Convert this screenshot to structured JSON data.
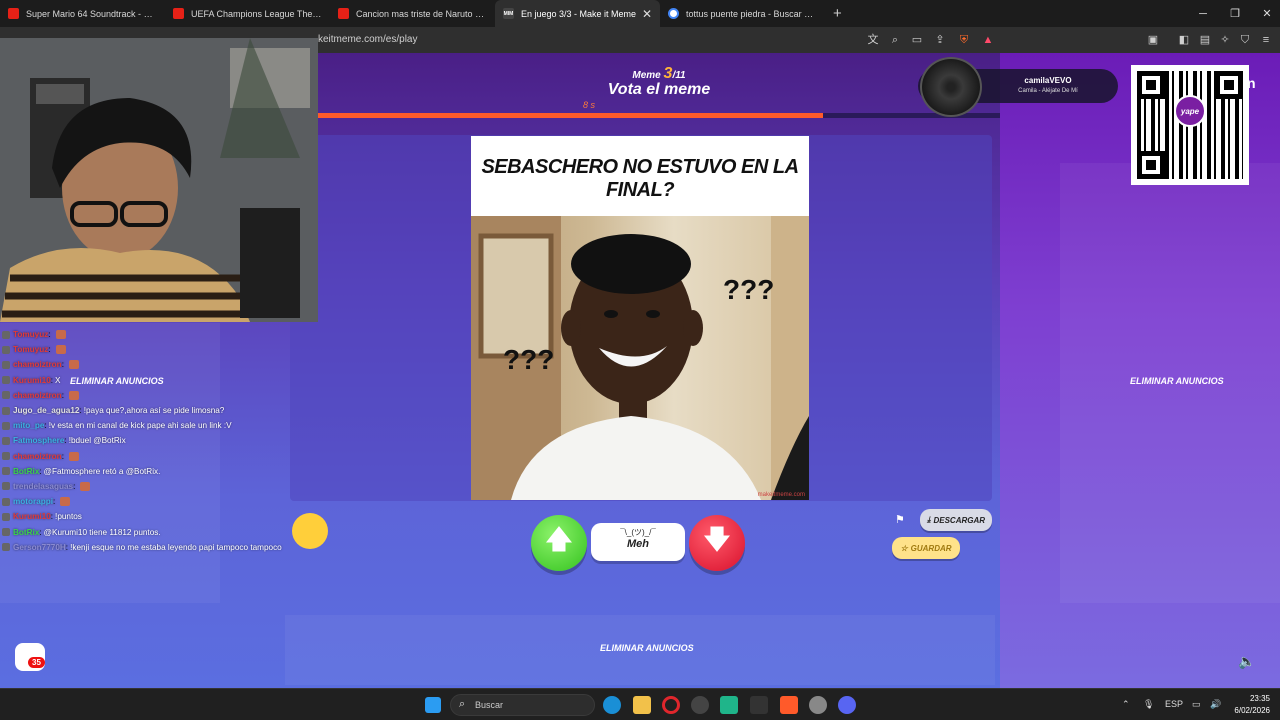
{
  "browser": {
    "tabs": [
      {
        "title": "Super Mario 64 Soundtrack - Staff Ro",
        "icon": "youtube-icon"
      },
      {
        "title": "UEFA Champions League Theme - Al",
        "icon": "youtube-icon"
      },
      {
        "title": "Cancion mas triste de Naruto (Sadne",
        "icon": "youtube-icon"
      },
      {
        "title": "En juego 3/3 - Make it Meme",
        "icon": "makeitmeme-icon",
        "active": true
      },
      {
        "title": "tottus puente piedra - Buscar con Go",
        "icon": "google-icon"
      }
    ],
    "active_tab_close": "✕",
    "new_tab": "+",
    "url": "keitmeme.com/es/play"
  },
  "game": {
    "round_label": "Meme",
    "round_current": "3",
    "round_total": "/11",
    "vote_title": "Vota el meme",
    "timer_label": "8 s",
    "timer_progress": 0.74,
    "meme": {
      "caption": "SEBASCHERO NO ESTUVO EN LA FINAL?",
      "question_marks_left": "???",
      "question_marks_right": "???",
      "watermark": "makeitmeme.com"
    },
    "buttons": {
      "meh_face": "¯\\_(ツ)_/¯",
      "meh_label": "Meh",
      "download_label": "DESCARGAR",
      "save_label": "GUARDAR"
    },
    "remove_ads_label": "ELIMINAR ANUNCIOS",
    "chat_count": "35"
  },
  "now_playing": {
    "user": "camilaVEVO",
    "song": "Camila - Aléjate De Mí",
    "edge_letter": "n"
  },
  "qr": {
    "brand": "yape"
  },
  "stream_chat": [
    {
      "user": "Tomuyuz",
      "msg": "",
      "user_color": "#e03a3a",
      "emote": true
    },
    {
      "user": "Tomuyuz",
      "msg": "",
      "user_color": "#e03a3a",
      "emote": true
    },
    {
      "user": "chamoiztron",
      "msg": "",
      "user_color": "#e03a3a",
      "emote": true
    },
    {
      "user": "Kurumi10",
      "msg": "X",
      "user_color": "#e03a3a",
      "emote": false
    },
    {
      "user": "chamoiztron",
      "msg": "",
      "user_color": "#e03a3a",
      "emote": true
    },
    {
      "user": "Jugo_de_agua12",
      "msg": "!paya que?,ahora así se pide limosna?",
      "user_color": "#e0e0e0",
      "emote": false
    },
    {
      "user": "mito_pe",
      "msg": "!v esta en mi canal de kick pape ahi sale un link :V",
      "user_color": "#3ab0e0",
      "emote": false
    },
    {
      "user": "Fatmosphere",
      "msg": "!bduel @BotRix",
      "user_color": "#3ab0e0",
      "emote": false
    },
    {
      "user": "chamoiztron",
      "msg": "",
      "user_color": "#e03a3a",
      "emote": true
    },
    {
      "user": "BotRix",
      "msg": "@Fatmosphere retó a @BotRix.",
      "user_color": "#3ad04a",
      "emote": false
    },
    {
      "user": "trendelasaguas",
      "msg": "",
      "user_color": "#8a8ad0",
      "emote": true
    },
    {
      "user": "motorappi",
      "msg": "",
      "user_color": "#3ab0e0",
      "emote": true
    },
    {
      "user": "Kurumi10",
      "msg": "!puntos",
      "user_color": "#e03a3a",
      "emote": false
    },
    {
      "user": "BotRix",
      "msg": "@Kurumi10 tiene 11812 puntos.",
      "user_color": "#3ad04a",
      "emote": false
    },
    {
      "user": "Gerson7770H",
      "msg": "!kenji esque no me estaba leyendo papi tampoco tampoco",
      "user_color": "#8a8ad0",
      "emote": false
    }
  ],
  "taskbar": {
    "search_placeholder": "Buscar",
    "language": "ESP",
    "time": "23:35",
    "date": "6/02/2026"
  },
  "colors": {
    "accent_orange": "#ff5a2a",
    "up_green": "#33c21e",
    "down_red": "#d8102c",
    "page_purple": "#5b3fb8"
  }
}
